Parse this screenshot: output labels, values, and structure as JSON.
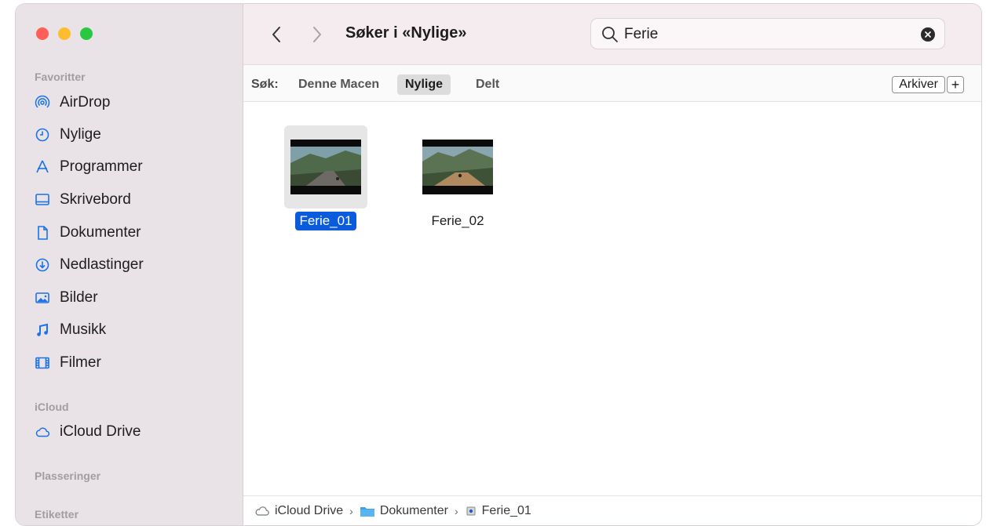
{
  "sidebar": {
    "sections": {
      "favorites": "Favoritter",
      "icloud": "iCloud",
      "locations": "Plasseringer",
      "tags": "Etiketter"
    },
    "items": [
      {
        "label": "AirDrop",
        "icon": "airdrop-icon"
      },
      {
        "label": "Nylige",
        "icon": "clock-icon"
      },
      {
        "label": "Programmer",
        "icon": "applications-icon"
      },
      {
        "label": "Skrivebord",
        "icon": "desktop-icon"
      },
      {
        "label": "Dokumenter",
        "icon": "document-icon"
      },
      {
        "label": "Nedlastinger",
        "icon": "download-icon"
      },
      {
        "label": "Bilder",
        "icon": "pictures-icon"
      },
      {
        "label": "Musikk",
        "icon": "music-icon"
      },
      {
        "label": "Filmer",
        "icon": "film-icon"
      }
    ],
    "icloud_items": [
      {
        "label": "iCloud Drive",
        "icon": "cloud-icon"
      }
    ]
  },
  "toolbar": {
    "title": "Søker i «Nylige»",
    "search_value": "Ferie"
  },
  "scopebar": {
    "label": "Søk:",
    "scopes": [
      "Denne Macen",
      "Nylige",
      "Delt"
    ],
    "active_scope": "Nylige",
    "save_label": "Arkiver",
    "add_label": "+"
  },
  "files": [
    {
      "name": "Ferie_01",
      "selected": true
    },
    {
      "name": "Ferie_02",
      "selected": false
    }
  ],
  "pathbar": {
    "segments": [
      "iCloud Drive",
      "Dokumenter",
      "Ferie_01"
    ],
    "separator": "›"
  },
  "colors": {
    "accent": "#1a73e8",
    "selection": "#0a5cdd",
    "sidebar_bg": "#e9e2e6",
    "toolbar_bg": "#f5ecef"
  }
}
